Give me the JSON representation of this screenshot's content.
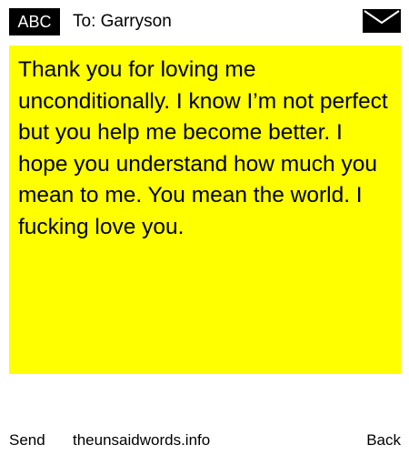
{
  "header": {
    "input_mode": "ABC",
    "recipient_label": "To: Garryson",
    "mail_icon": "envelope-icon"
  },
  "message": {
    "body": "Thank you for loving me unconditionally. I know I’m not perfect but you help me become better. I hope you understand how much you mean to me. You mean the world. I fucking love you.",
    "background_color": "#ffff00"
  },
  "footer": {
    "send_label": "Send",
    "site_label": "theunsaidwords.info",
    "back_label": "Back"
  }
}
